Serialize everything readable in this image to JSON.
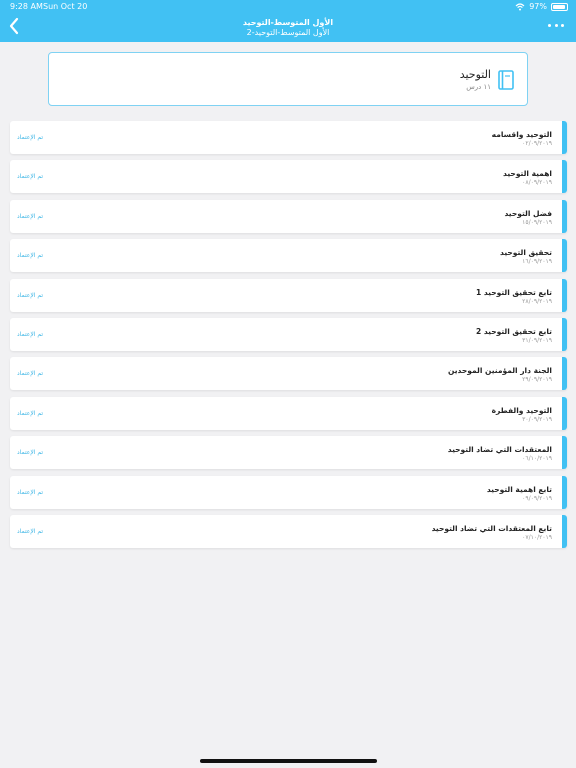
{
  "status_bar": {
    "time": "9:28 AM",
    "date": "Sun Oct 20",
    "battery": "97%"
  },
  "header": {
    "title_line1": "الأول المتوسط-التوحيد",
    "title_line2": "الأول المتوسط-التوحيد-2",
    "color": "#41c1f3"
  },
  "subject": {
    "name": "التوحيد",
    "count": "١١ درس"
  },
  "lessons": [
    {
      "title": "التوحيد واقسامه",
      "date": "٠٢/٠٩/٢٠١٩",
      "status": "تم الإعتماد"
    },
    {
      "title": "اهمية التوحيد",
      "date": "٠٨/٠٩/٢٠١٩",
      "status": "تم الإعتماد"
    },
    {
      "title": "فضل التوحيد",
      "date": "١٥/٠٩/٢٠١٩",
      "status": "تم الإعتماد"
    },
    {
      "title": "تحقيق التوحيد",
      "date": "١٦/٠٩/٢٠١٩",
      "status": "تم الإعتماد"
    },
    {
      "title": "تابع تحقيق التوحيد 1",
      "date": "٢٨/٠٩/٢٠١٩",
      "status": "تم الإعتماد"
    },
    {
      "title": "تابع تحقيق التوحيد 2",
      "date": "٣١/٠٩/٢٠١٩",
      "status": "تم الإعتماد"
    },
    {
      "title": "الجنة دار المؤمنين الموحدين",
      "date": "٢٩/٠٩/٢٠١٩",
      "status": "تم الإعتماد"
    },
    {
      "title": "التوحيد والفطرة",
      "date": "٣٠/٠٩/٢٠١٩",
      "status": "تم الإعتماد"
    },
    {
      "title": "المعتقدات التي تضاد التوحيد",
      "date": "٠٦/١٠/٢٠١٩",
      "status": "تم الإعتماد"
    },
    {
      "title": "تابع اهمية التوحيد",
      "date": "٠٩/٠٩/٢٠١٩",
      "status": "تم الإعتماد"
    },
    {
      "title": "تابع المعتقدات التي تضاد التوحيد",
      "date": "٠٧/١٠/٢٠١٩",
      "status": "تم الإعتماد"
    }
  ]
}
